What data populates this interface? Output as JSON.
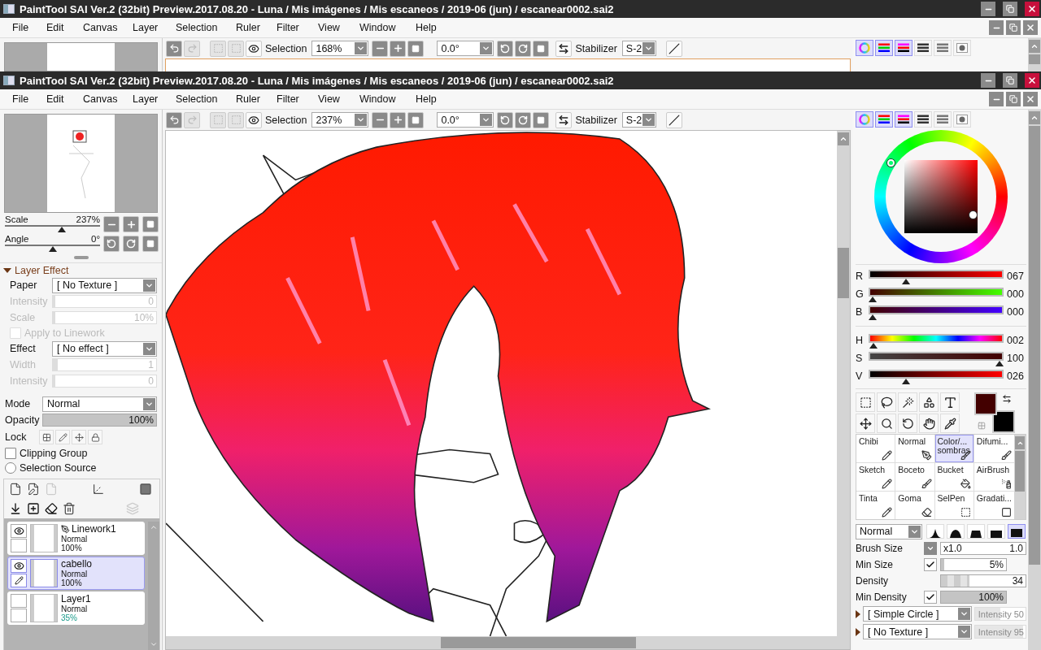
{
  "back_window": {
    "title": "PaintTool SAI Ver.2 (32bit) Preview.2017.08.20 - Luna / Mis imágenes / Mis escaneos / 2019-06 (jun) / escanear0002.sai2",
    "menu": [
      "File",
      "Edit",
      "Canvas",
      "Layer",
      "Selection",
      "Ruler",
      "Filter",
      "View",
      "Window",
      "Help"
    ],
    "toolbar": {
      "selection": "Selection",
      "zoom": "168%",
      "angle": "0.0°",
      "stabilizer_label": "Stabilizer",
      "stabilizer": "S-2"
    },
    "color_tabs": [
      {
        "selected": true
      },
      {
        "selected": true
      },
      {
        "selected": true
      },
      {
        "selected": false
      },
      {
        "selected": false
      },
      {
        "selected": false
      }
    ]
  },
  "window": {
    "title": "PaintTool SAI Ver.2 (32bit) Preview.2017.08.20 - Luna / Mis imágenes / Mis escaneos / 2019-06 (jun) / escanear0002.sai2",
    "menu": [
      "File",
      "Edit",
      "Canvas",
      "Layer",
      "Selection",
      "Ruler",
      "Filter",
      "View",
      "Window",
      "Help"
    ],
    "toolbar": {
      "selection": "Selection",
      "zoom": "237%",
      "angle": "0.0°",
      "stabilizer_label": "Stabilizer",
      "stabilizer": "S-2"
    }
  },
  "navigator": {
    "scale": {
      "label": "Scale",
      "value": "237%",
      "level": 0.6
    },
    "angle": {
      "label": "Angle",
      "value": "0°",
      "level": 0.5
    }
  },
  "layer_effect": {
    "title": "Layer Effect",
    "expanded": true,
    "fields": [
      {
        "kind": "select",
        "label": "Paper",
        "value": "[ No Texture ]",
        "disabled": false
      },
      {
        "kind": "slider",
        "label": "Intensity",
        "value": "0",
        "level": 0,
        "disabled": true
      },
      {
        "kind": "slider",
        "label": "Scale",
        "value": "10%",
        "level": 0.02,
        "disabled": true
      },
      {
        "kind": "checkbox",
        "label": "Apply to Linework",
        "checked": false,
        "disabled": true
      },
      {
        "kind": "select",
        "label": "Effect",
        "value": "[ No effect ]",
        "disabled": false
      },
      {
        "kind": "slider",
        "label": "Width",
        "value": "1",
        "level": 0.05,
        "disabled": true
      },
      {
        "kind": "slider",
        "label": "Intensity",
        "value": "0",
        "level": 0,
        "disabled": true
      }
    ]
  },
  "layer_props": {
    "mode_label": "Mode",
    "mode": "Normal",
    "opacity": {
      "label": "Opacity",
      "value": "100%",
      "level": 1
    },
    "lock_label": "Lock",
    "options": [
      {
        "kind": "checkbox",
        "label": "Clipping Group",
        "checked": false
      },
      {
        "kind": "radio",
        "label": "Selection Source",
        "checked": false
      }
    ]
  },
  "layers": [
    {
      "kind": "linework",
      "name": "Linework1",
      "mode": "Normal",
      "opacity": "100%",
      "opacity_reduced": false,
      "visible": true,
      "selected": false
    },
    {
      "kind": "normal",
      "name": "cabello",
      "mode": "Normal",
      "opacity": "100%",
      "opacity_reduced": false,
      "visible": true,
      "selected": true
    },
    {
      "kind": "normal",
      "name": "Layer1",
      "mode": "Normal",
      "opacity": "35%",
      "opacity_reduced": true,
      "visible": false,
      "selected": false
    }
  ],
  "color_panel": {
    "tabs": [
      {
        "selected": true
      },
      {
        "selected": true
      },
      {
        "selected": true
      },
      {
        "selected": false
      },
      {
        "selected": false
      },
      {
        "selected": false
      }
    ],
    "sliders": [
      {
        "kind": "r",
        "label": "R",
        "value": "067",
        "level": 0.263
      },
      {
        "kind": "g",
        "label": "G",
        "value": "000",
        "level": 0
      },
      {
        "kind": "b",
        "label": "B",
        "value": "000",
        "level": 0
      },
      {
        "kind": "h",
        "label": "H",
        "value": "002",
        "level": 0.006
      },
      {
        "kind": "s",
        "label": "S",
        "value": "100",
        "level": 1
      },
      {
        "kind": "v",
        "label": "V",
        "value": "026",
        "level": 0.26
      }
    ],
    "swatches": [
      {
        "color": "#430000"
      },
      {
        "color": "#000000"
      }
    ]
  },
  "brushes": [
    {
      "name": "Chibi",
      "selected": false
    },
    {
      "name": "Normal",
      "selected": false
    },
    {
      "name": "Color/... sombras",
      "selected": true
    },
    {
      "name": "Difumi...",
      "selected": false
    },
    {
      "name": "Sketch",
      "selected": false
    },
    {
      "name": "Boceto",
      "selected": false
    },
    {
      "name": "Bucket",
      "selected": false
    },
    {
      "name": "AirBrush",
      "selected": false
    },
    {
      "name": "Tinta",
      "selected": false
    },
    {
      "name": "Goma",
      "selected": false
    },
    {
      "name": "SelPen",
      "selected": false
    },
    {
      "name": "Gradati...",
      "selected": false
    }
  ],
  "brush_settings": {
    "blend": "Normal",
    "shapes": [
      {
        "selected": false
      },
      {
        "selected": false
      },
      {
        "selected": false
      },
      {
        "selected": false
      },
      {
        "selected": true
      }
    ],
    "rows": [
      {
        "kind": "size",
        "label": "Brush Size",
        "multiplier": "x1.0",
        "value": "1.0"
      },
      {
        "kind": "check",
        "label": "Min Size",
        "checked": true,
        "value": "5%",
        "level": 0.05
      },
      {
        "kind": "density",
        "label": "Density",
        "value": "34",
        "level": 0.34
      },
      {
        "kind": "check",
        "label": "Min Density",
        "checked": true,
        "value": "100%",
        "level": 1
      }
    ],
    "textures": [
      {
        "value": "[ Simple Circle ]",
        "intensity": "Intensity 50",
        "level": 0.5
      },
      {
        "value": "[ No Texture ]",
        "intensity": "Intensity 95",
        "level": 0.95
      }
    ]
  }
}
